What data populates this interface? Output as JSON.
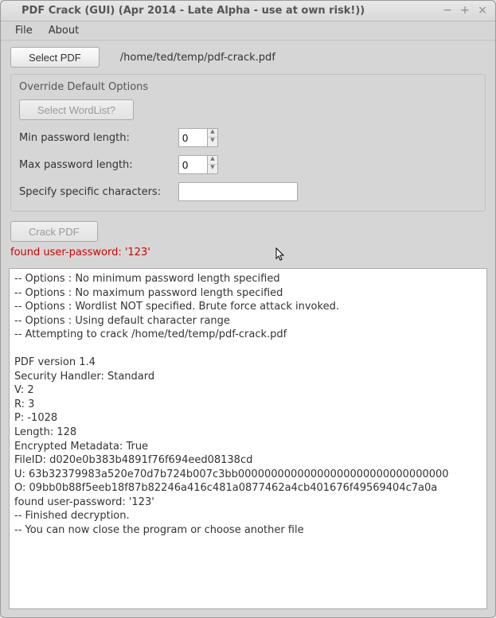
{
  "window": {
    "title": "PDF Crack (GUI) (Apr 2014 - Late Alpha - use at own risk!))"
  },
  "menu": {
    "file": "File",
    "about": "About"
  },
  "toolbar": {
    "select_pdf": "Select PDF",
    "pdf_path": "/home/ted/temp/pdf-crack.pdf"
  },
  "options": {
    "title": "Override Default Options",
    "select_wordlist": "Select WordList?",
    "min_label": "Min password length:",
    "min_value": "0",
    "max_label": "Max password length:",
    "max_value": "0",
    "chars_label": "Specify specific characters:",
    "chars_value": ""
  },
  "crack": {
    "label": "Crack PDF"
  },
  "result": {
    "text": "found user-password: '123'"
  },
  "output_lines": [
    "-- Options : No minimum password length specified",
    "-- Options : No maximum password length specified",
    "-- Options : Wordlist NOT specified. Brute force attack invoked.",
    "-- Options : Using default character range",
    "-- Attempting to crack /home/ted/temp/pdf-crack.pdf",
    "",
    "PDF version 1.4",
    "Security Handler: Standard",
    "V: 2",
    "R: 3",
    "P: -1028",
    "Length: 128",
    "Encrypted Metadata: True",
    "FileID: d020e0b383b4891f76f694eed08138cd",
    "U: 63b32379983a520e70d7b724b007c3bb00000000000000000000000000000000",
    "O: 09bb0b88f5eeb18f87b82246a416c481a0877462a4cb401676f49569404c7a0a",
    "found user-password: '123'",
    "-- Finished decryption.",
    "-- You can now close the program or choose another file"
  ]
}
